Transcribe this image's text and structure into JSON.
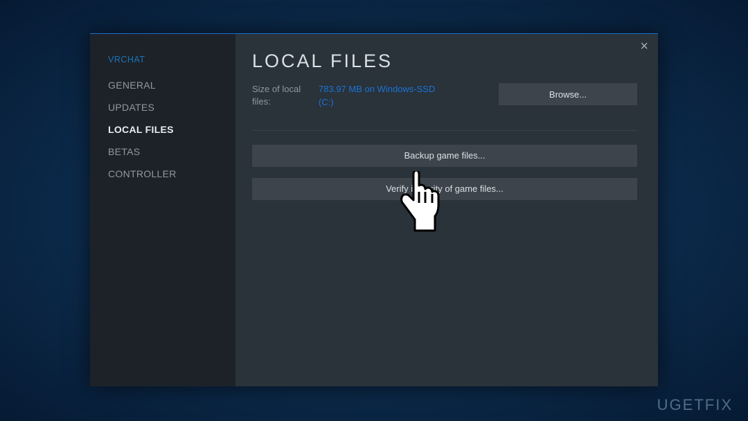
{
  "sidebar": {
    "game_title": "VRCHAT",
    "items": [
      {
        "label": "GENERAL"
      },
      {
        "label": "UPDATES"
      },
      {
        "label": "LOCAL FILES"
      },
      {
        "label": "BETAS"
      },
      {
        "label": "CONTROLLER"
      }
    ],
    "active_index": 2
  },
  "header": {
    "title": "LOCAL FILES",
    "close": "×"
  },
  "info": {
    "size_label": "Size of local files:",
    "size_value_line1": "783.97 MB on Windows-SSD",
    "size_value_line2": "(C:)",
    "browse_label": "Browse..."
  },
  "actions": {
    "backup_label": "Backup game files...",
    "verify_label": "Verify integrity of game files..."
  },
  "watermark": "UGETFIX"
}
